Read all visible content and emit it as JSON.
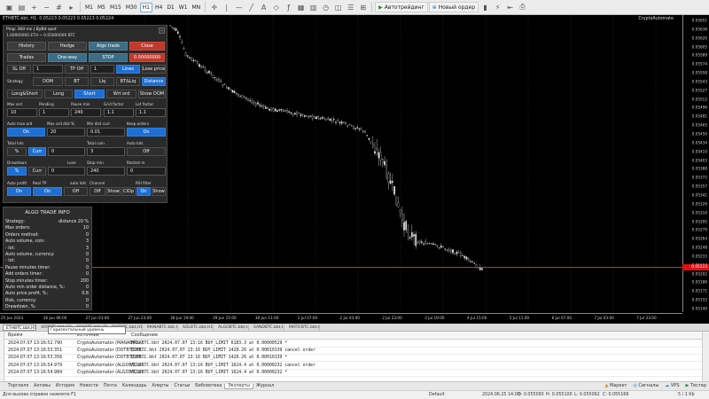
{
  "toolbar": {
    "timeframes": [
      "M1",
      "M5",
      "M15",
      "M30",
      "H1",
      "H4",
      "D1",
      "W1",
      "MN"
    ],
    "active_timeframe": "H1",
    "algo_button": "Автотрейдинг",
    "new_order_button": "Новый ордер"
  },
  "chart": {
    "symbol_info": "ETHBTC.bbt, H1: 0.05223 0.05223 0.05223 0.05224",
    "brand": "CryptoAutomate",
    "price_labels": [
      "0.05651",
      "0.05636",
      "0.05620",
      "0.05605",
      "0.05589",
      "0.05574",
      "0.05558",
      "0.05543",
      "0.05527",
      "0.05512",
      "0.05496",
      "0.05481",
      "0.05465",
      "0.05450",
      "0.05434",
      "0.05419",
      "0.05403",
      "0.05388",
      "0.05372",
      "0.05357",
      "0.05341",
      "0.05326",
      "0.05310",
      "0.05295",
      "0.05279",
      "0.05264",
      "0.05248",
      "0.05233",
      "0.05217",
      "0.05202",
      "0.05186",
      "0.05171",
      "0.05155",
      "0.05140"
    ],
    "current_price": "0.05223",
    "time_labels": [
      "25 Jun 2024",
      "26 Jun 06:00",
      "27 Jun 03:00",
      "27 Jun 23:00",
      "28 Jun 19:00",
      "29 Jun 15:00",
      "30 Jun 11:00",
      "1 Jul 07:00",
      "2 Jul 03:00",
      "2 Jul 23:00",
      "3 Jul 19:00",
      "4 Jul 15:00",
      "5 Jul 11:00",
      "6 Jul 07:00",
      "7 Jul 03:00",
      "7 Jul 23:00"
    ]
  },
  "panel": {
    "title": "Ping: 360 ms | ByBit spot",
    "subtitle": "1.00000000 ETH ~ 0.05000000 BTC",
    "history": "History",
    "hedge": "Hedge",
    "algo_trade": "Algo trade",
    "close": "Close",
    "trades": "Trades",
    "one_way": "One-way",
    "stop": "STOP",
    "close_value": "0.00000000",
    "sl_off": "SL Off",
    "sl_value": "1",
    "tp_off": "TP Off",
    "tp_value": "1",
    "lines": "Lines",
    "lose_price": "Lose price",
    "strategy": "Strategy",
    "dom": "DOM",
    "bt": "BT",
    "liq": "Liq",
    "bt_liq": "BT&Liq",
    "distance": "Distance",
    "long_short": "Long&Short",
    "long": "Long",
    "short": "Short",
    "wrt_ord": "Wrt ord",
    "show_dom": "Show DOM",
    "max_ord": "Max ord",
    "pending": "Pending",
    "pause_min": "Pause min",
    "grid_factor": "Grid factor",
    "lot_factor": "Lot factor",
    "max_ord_v": "10",
    "pending_v": "1",
    "pause_min_v": "240",
    "grid_factor_v": "1.1",
    "lot_factor_v": "1.1",
    "auto_max_ord": "Auto max ord",
    "max_ord_dist": "Max ord dist %",
    "min_dist_curr": "Min dist curr",
    "keep_orders": "Keep orders",
    "on": "On",
    "max_ord_dist_v": "20",
    "min_dist_curr_v": "0.01",
    "total_lots": "Total lots",
    "total_coin": "Total coin",
    "auto_lots": "Auto lots",
    "pct": "%",
    "curr": "Curr",
    "total_lots_v": "0",
    "total_coin_v": "3",
    "off": "Off",
    "drawdown": "Drawdown",
    "lose": "Lose",
    "stop_min": "Stop min",
    "restart_m": "Restart m",
    "lose_v": "0",
    "stop_min_v": "240",
    "restart_v": "0",
    "auto_profit": "Auto profit",
    "real_tp": "Real TP",
    "auto_lots2": "auto lots",
    "channel": "Channel",
    "rsi_filter": "RSI filter",
    "show": "Show",
    "clop": "ClOp"
  },
  "info": {
    "title": "ALGO TRADE INFO",
    "rows": [
      {
        "label": "Strategy:",
        "value": "distance 20 %"
      },
      {
        "label": "Max orders:",
        "value": "10"
      },
      {
        "label": "Orders method:",
        "value": "0"
      },
      {
        "label": "Auto volume, coin:",
        "value": "3"
      },
      {
        "label": " - lot:",
        "value": "3"
      },
      {
        "label": "Auto volume, currency:",
        "value": "0"
      },
      {
        "label": " - lot:",
        "value": "0"
      },
      {
        "label": "Pause minutes timer:",
        "value": "0"
      },
      {
        "label": "Add orders timer:",
        "value": "0"
      },
      {
        "label": "Stop minutes timer:",
        "value": "200"
      },
      {
        "label": "Auto min order distance, %:",
        "value": "0"
      },
      {
        "label": "Auto price profit, %:",
        "value": "0.8"
      },
      {
        "label": "Risk, currency:",
        "value": "0"
      },
      {
        "label": "Drawdown, %:",
        "value": "0"
      }
    ]
  },
  "symbol_tabs": [
    "ETHBTC.bbt,H1",
    "XRPBTC.bbt,H1",
    "ADABTC.bbt,H1",
    "DOTBTC.bbt,H1",
    "MANABTC.bbt,H1",
    "SOLBTC.bbt,H1",
    "ALGOBTC.bbt,H1",
    "SANDBTC.bbt,H1",
    "MATICBTC.bbt,H1"
  ],
  "tooltip": "Горизонтальный уровень",
  "journal": {
    "headers": {
      "time": "Время",
      "source": "Источник",
      "message": "Сообщение"
    },
    "rows": [
      {
        "time": "2024.07.07 13:16:52.790",
        "source": "CryptoAutomator (MANABTC...",
        "message": "MANABTC.bbt 2024.07.07 13:16 BUY_LIMIT 6183.3 at 0.00000529 *"
      },
      {
        "time": "2024.07.07 13:16:53.351",
        "source": "CryptoAutomator (DOTBTC.bb...",
        "message": "DOTBTC.bbt 2024.07.07 13:16 BUY_LIMIT 1428.26 at 0.00010139 cancel order"
      },
      {
        "time": "2024.07.07 13:16:53.356",
        "source": "CryptoAutomator (DOTBTC.bb...",
        "message": "DOTBTC.bbt 2024.07.07 13:16 BUY_LIMIT 1428.26 at 0.00010139 *"
      },
      {
        "time": "2024.07.07 13:16:54.979",
        "source": "CryptoAutomator (ALGOBTC.b...",
        "message": "ALGOBTC.bbt 2024.07.07 13:16 BUY_LIMIT 1624.4 at 0.00000232 cancel order"
      },
      {
        "time": "2024.07.07 13:16:54.984",
        "source": "CryptoAutomator (ALGOBTC.b...",
        "message": "ALGOBTC.bbt 2024.07.07 13:16 BUY_LIMIT 1624.4 at 0.00000232 *"
      }
    ]
  },
  "bottom_tabs": [
    "Торговля",
    "Активы",
    "История",
    "Новости",
    "Почта",
    "Календарь",
    "Алерты",
    "Статьи",
    "Библиотека",
    "Эксперты",
    "Журнал"
  ],
  "active_bottom_tab": "Эксперты",
  "bottom_right": {
    "market": "Маркет",
    "signals": "Сигналы",
    "vps": "VPS",
    "tester": "Тестер"
  },
  "status": {
    "help": "Для вызова справки нажмите F1",
    "profile": "Default",
    "datetime": "2024.06.25 14:00",
    "open": "O: 0.055093",
    "high": "H: 0.055100",
    "low": "L: 0.055062",
    "close": "C: 0.055166",
    "traffic": "5 / 1 Kb"
  }
}
